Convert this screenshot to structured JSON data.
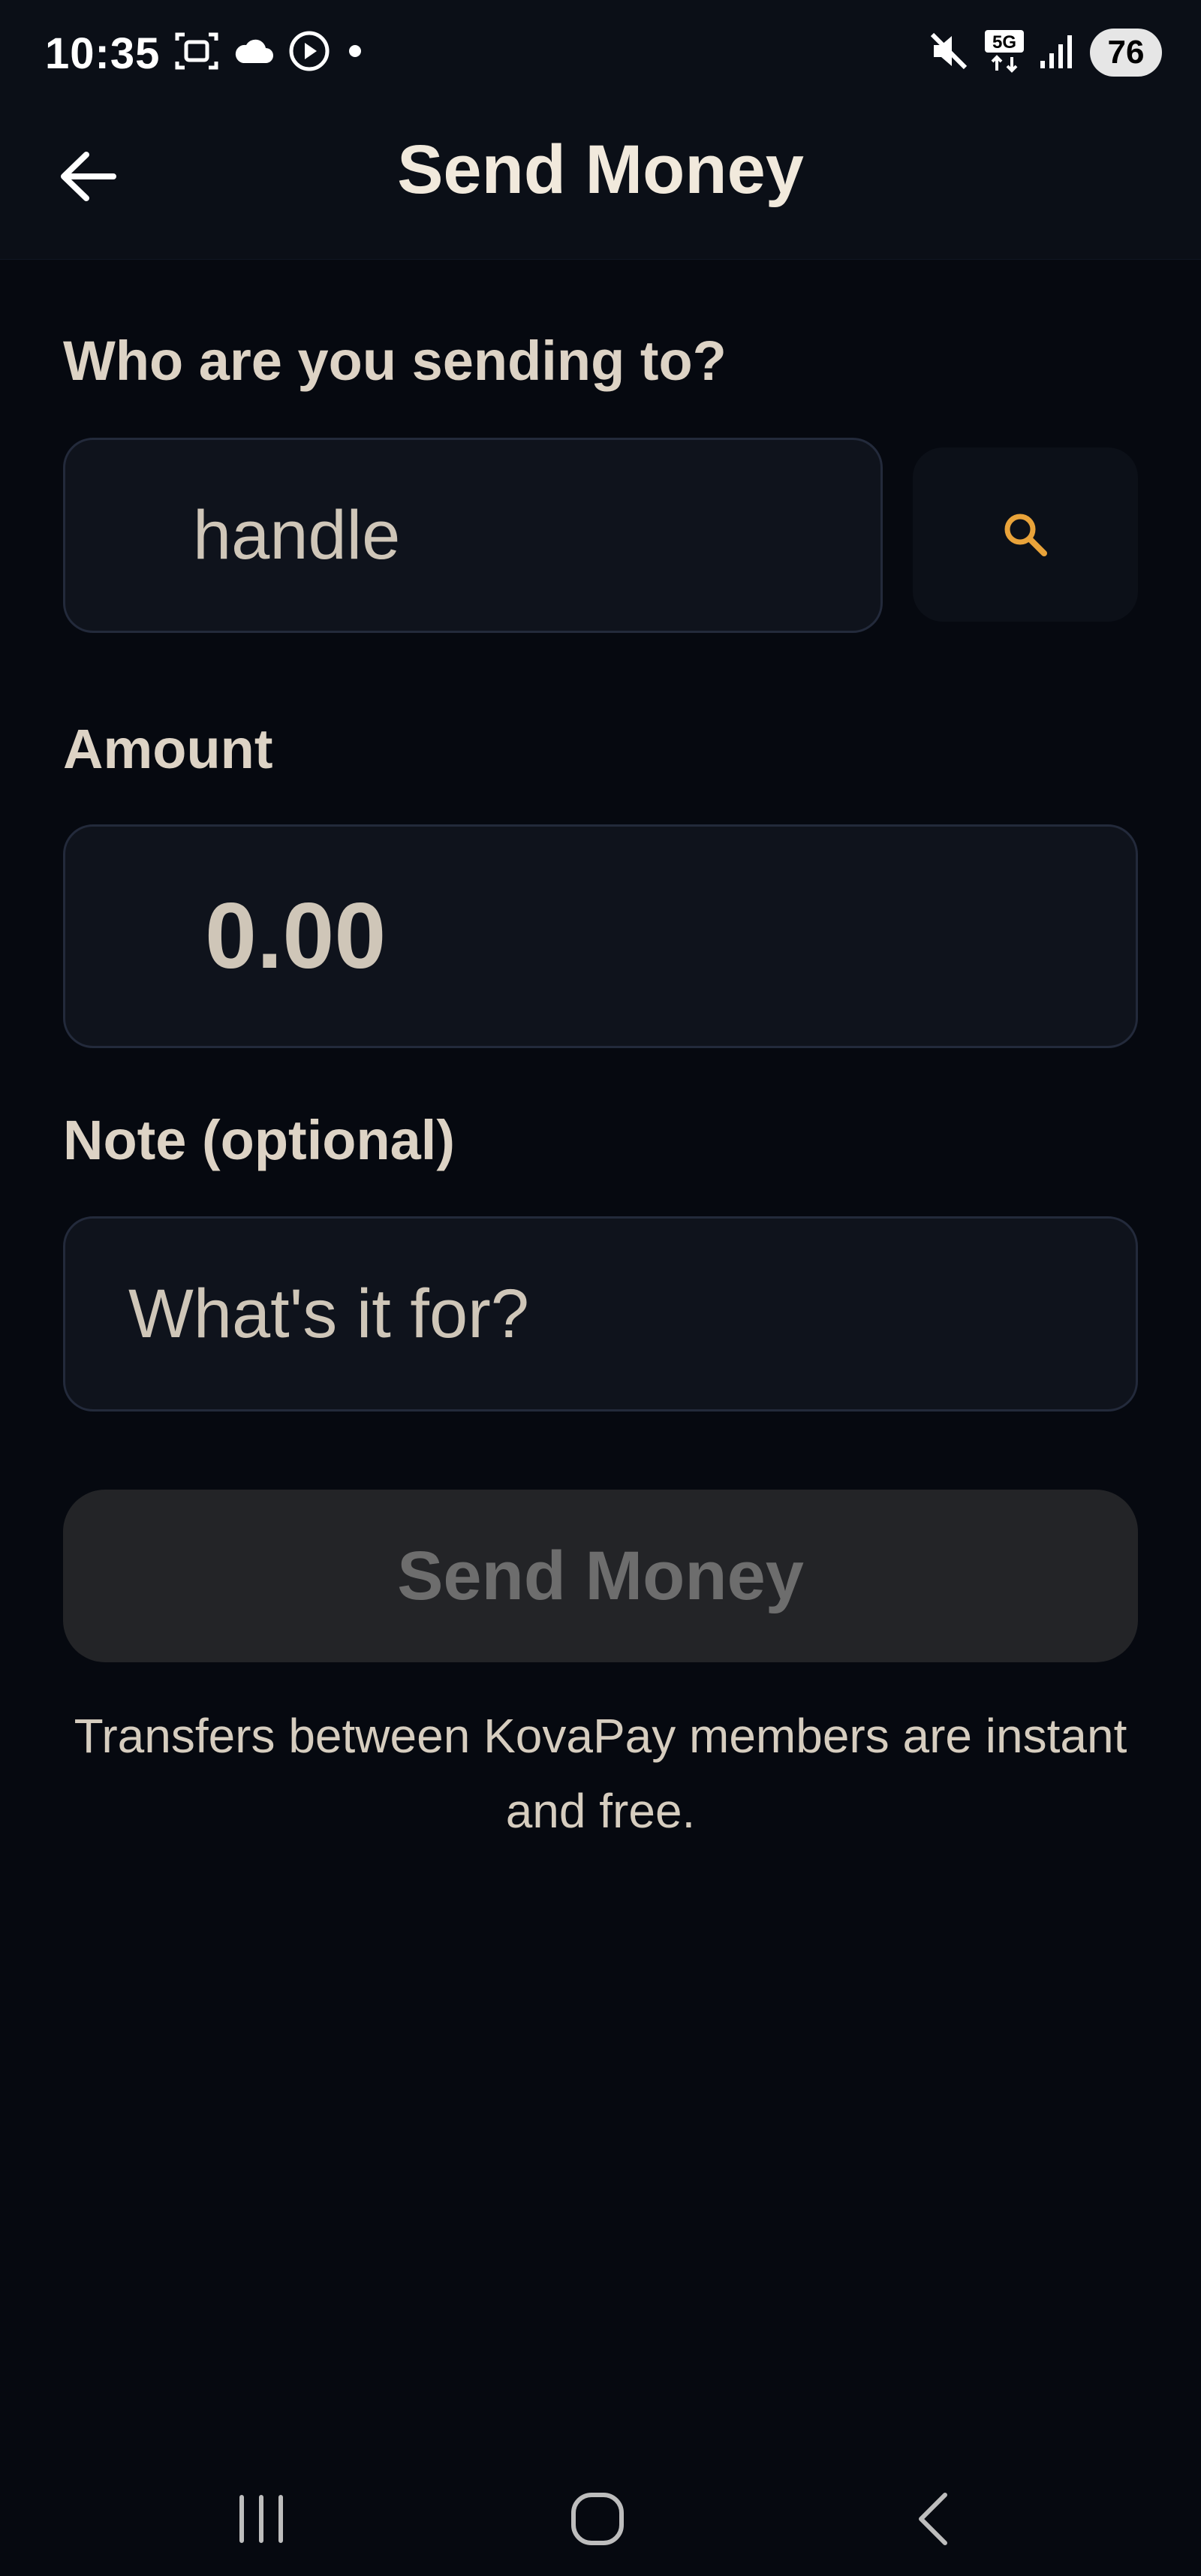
{
  "status_bar": {
    "time": "10:35",
    "battery": "76",
    "network": "5G"
  },
  "header": {
    "title": "Send Money"
  },
  "recipient": {
    "label": "Who are you sending to?",
    "placeholder": "handle"
  },
  "amount": {
    "label": "Amount",
    "placeholder": "0.00"
  },
  "note": {
    "label": "Note (optional)",
    "placeholder": "What's it for?"
  },
  "send_button": {
    "label": "Send Money"
  },
  "footer": {
    "text": "Transfers between KovaPay members are instant and free."
  },
  "colors": {
    "background": "#060910",
    "accent": "#e9a33a",
    "field_bg": "#0f131c",
    "field_border": "#232a3b",
    "button_disabled_bg": "#232427",
    "button_disabled_text": "#6d6d6d"
  },
  "icons": {
    "back": "arrow-left-icon",
    "search": "search-icon"
  }
}
